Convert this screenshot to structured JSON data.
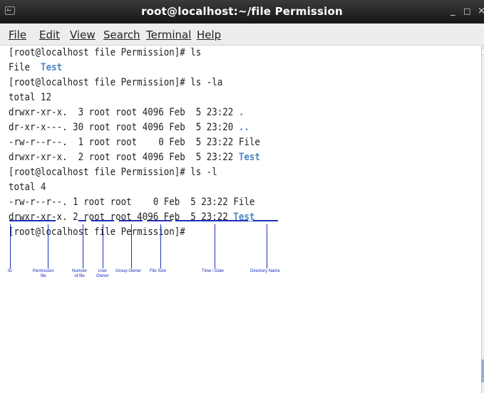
{
  "window": {
    "title": "root@localhost:~/file Permission",
    "minimize_glyph": "_",
    "maximize_glyph": "□",
    "close_glyph": "×"
  },
  "menu": [
    {
      "label": "File"
    },
    {
      "label": "Edit"
    },
    {
      "label": "View"
    },
    {
      "label": "Search"
    },
    {
      "label": "Terminal"
    },
    {
      "label": "Help"
    }
  ],
  "terminal": {
    "l1": "[root@localhost file Permission]# ls",
    "l2_a": "File",
    "l2_b": "Test",
    "l3": "[root@localhost file Permission]# ls -la",
    "l4": "total 12",
    "l5_a": "drwxr-xr-x.  3 root root 4096 Feb  5 23:22 ",
    "l5_b": ".",
    "l6_a": "dr-xr-x---. 30 root root 4096 Feb  5 23:20 ",
    "l6_b": "..",
    "l7": "-rw-r--r--.  1 root root    0 Feb  5 23:22 File",
    "l8_a": "drwxr-xr-x.  2 root root 4096 Feb  5 23:22 ",
    "l8_b": "Test",
    "l9": "[root@localhost file Permission]# ls -l",
    "l10": "total 4",
    "l11": "-rw-r--r--. 1 root root    0 Feb  5 23:22 File",
    "l12_a": "drwxr-xr-x. 2 root root 4096 Feb  5 23:22 ",
    "l12_b": "Test",
    "l13": "[root@localhost file Permission]# "
  },
  "annotations": {
    "id": "ID",
    "permission": "Permission\nfile",
    "number": "Numver\nof file",
    "user": "User\nOwner",
    "group": "Group Owner",
    "size": "File Size",
    "time": "Time / Date",
    "dir": "Directory Name"
  },
  "colors": {
    "directory": "#4a86c8",
    "annotation": "#1f2fb8",
    "titlebar": "#1e1e1e"
  }
}
